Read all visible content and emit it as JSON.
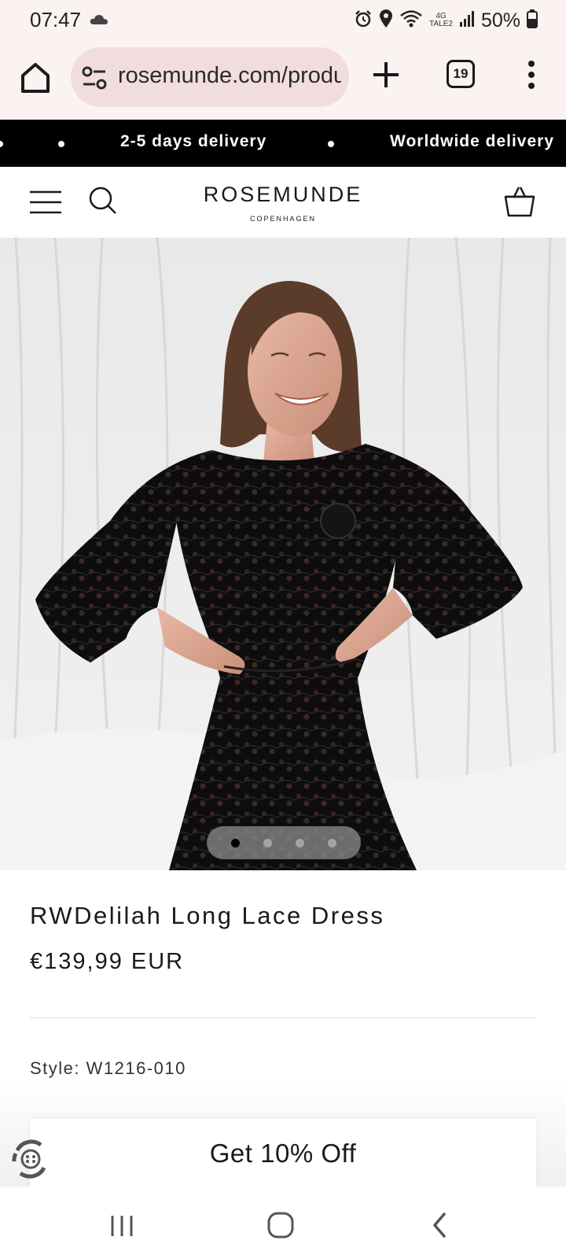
{
  "status_bar": {
    "time": "07:47",
    "network_top": "4G",
    "network_bottom": "TALE2",
    "battery": "50%"
  },
  "browser": {
    "url": "rosemunde.com/products/rwdelilah",
    "tab_count": "19"
  },
  "announcement": {
    "messages": [
      "2-5 days delivery",
      "Worldwide delivery"
    ]
  },
  "header": {
    "brand_name": "ROSEMUNDE",
    "brand_sub": "COPENHAGEN"
  },
  "gallery": {
    "slide_count": 4,
    "active_slide": 1
  },
  "product": {
    "title": "RWDelilah Long Lace Dress",
    "price": "€139,99 EUR",
    "style": "Style: W1216-010"
  },
  "popup": {
    "discount_label": "Get 10% Off"
  },
  "icons": {
    "status": [
      "cloud-icon",
      "alarm-icon",
      "location-icon",
      "wifi-icon",
      "signal-icon",
      "battery-icon"
    ],
    "browser": [
      "home-icon",
      "site-settings-icon",
      "plus-icon",
      "tabs-icon",
      "more-vert-icon"
    ],
    "header": [
      "menu-icon",
      "search-icon",
      "basket-icon"
    ],
    "nav": [
      "recent-apps-icon",
      "home-nav-icon",
      "back-icon"
    ]
  },
  "colors": {
    "chrome_bg": "#fbf3f2",
    "url_pill": "#f1dde0",
    "announcement_bg": "#000000",
    "text": "#1a1a1a"
  }
}
